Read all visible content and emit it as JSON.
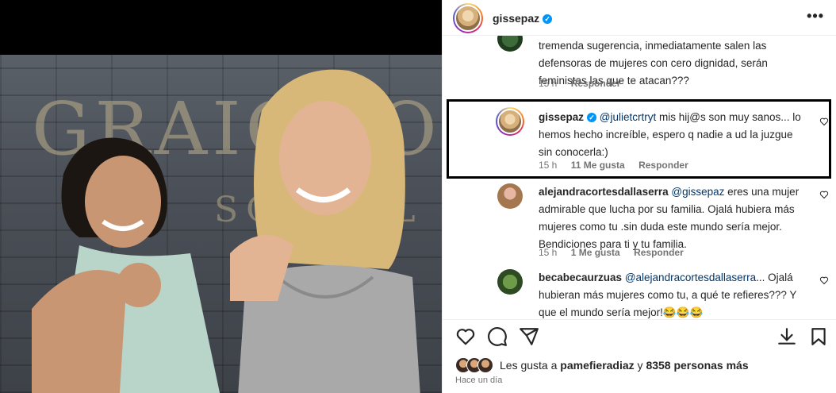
{
  "post": {
    "username": "gissepaz",
    "more_label": "•••"
  },
  "comments": [
    {
      "username": "",
      "text": "tremenda sugerencia, inmediatamente salen las defensoras de mujeres con cero dignidad, serán feministas las que te atacan???",
      "time": "15 h",
      "likes": "",
      "reply": "Responder"
    },
    {
      "username": "gissepaz",
      "mention": "@julietcrtryt",
      "text": "mis hij@s son muy sanos... lo hemos hecho increíble, espero q nadie a ud la juzgue sin conocerla:)",
      "time": "15 h",
      "likes": "11 Me gusta",
      "reply": "Responder"
    },
    {
      "username": "alejandracortesdallaserra",
      "mention": "@gissepaz",
      "text": "eres una mujer admirable que lucha por su familia. Ojalá hubiera más mujeres como tu .sin duda este mundo sería mejor. Bendiciones para ti y tu familia.",
      "time": "15 h",
      "likes": "1 Me gusta",
      "reply": "Responder"
    },
    {
      "username": "becabecaurzuas",
      "mention": "@alejandracortesdallaserra",
      "text": "... Ojalá hubieran más mujeres como tu, a qué te refieres??? Y que el mundo sería mejor!😂😂😂"
    }
  ],
  "likes_row": {
    "prefix": "Les gusta a",
    "user": "pamefieradiaz",
    "connector": "y",
    "others": "8358 personas más"
  },
  "timestamp": "Hace un día",
  "photo_sign": {
    "line1": "GRAIGHOU",
    "line2": "SCHOOL"
  }
}
